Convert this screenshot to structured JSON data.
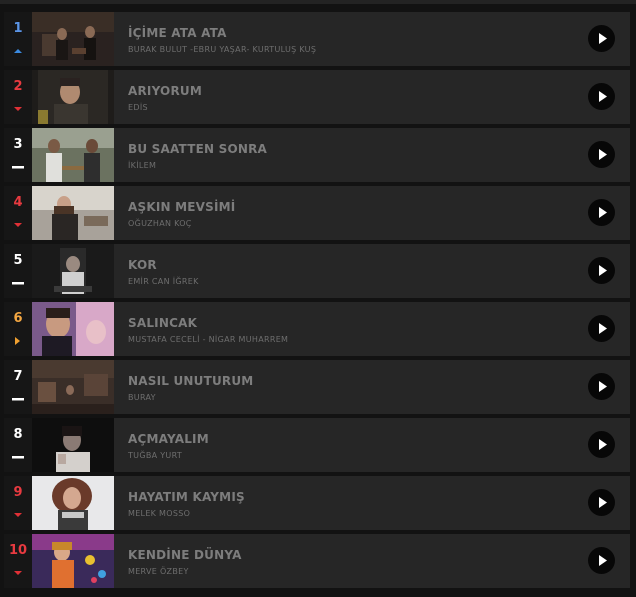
{
  "colors": {
    "up": "#3a8ae0",
    "down": "#e03036",
    "same": "#ffffff",
    "new": "#f0a030",
    "rank_up": "#5b95e8",
    "rank_down": "#e83a40",
    "rank_same": "#ffffff",
    "rank_new": "#f4a742"
  },
  "chart": {
    "items": [
      {
        "rank": "1",
        "trend": "up",
        "title": "İÇİME ATA ATA",
        "artist": "BURAK BULUT -EBRU YAŞAR- KURTULUŞ KUŞ",
        "play_icon": "play-icon"
      },
      {
        "rank": "2",
        "trend": "down",
        "title": "ARIYORUM",
        "artist": "EDİS",
        "play_icon": "play-icon"
      },
      {
        "rank": "3",
        "trend": "same",
        "title": "BU SAATTEN SONRA",
        "artist": "İKİLEM",
        "play_icon": "play-icon"
      },
      {
        "rank": "4",
        "trend": "down",
        "title": "AŞKIN MEVSİMİ",
        "artist": "OĞUZHAN KOÇ",
        "play_icon": "play-icon"
      },
      {
        "rank": "5",
        "trend": "same",
        "title": "KOR",
        "artist": "EMİR CAN İĞREK",
        "play_icon": "play-icon"
      },
      {
        "rank": "6",
        "trend": "new",
        "title": "SALINCAK",
        "artist": "MUSTAFA CECELİ - NİGAR MUHARREM",
        "play_icon": "play-icon"
      },
      {
        "rank": "7",
        "trend": "same",
        "title": "NASIL UNUTURUM",
        "artist": "BURAY",
        "play_icon": "play-icon"
      },
      {
        "rank": "8",
        "trend": "same",
        "title": "AÇMAYALIM",
        "artist": "TUĞBA YURT",
        "play_icon": "play-icon"
      },
      {
        "rank": "9",
        "trend": "down",
        "title": "HAYATIM KAYMIŞ",
        "artist": "MELEK MOSSO",
        "play_icon": "play-icon"
      },
      {
        "rank": "10",
        "trend": "down",
        "title": "KENDİNE DÜNYA",
        "artist": "MERVE ÖZBEY",
        "play_icon": "play-icon"
      }
    ]
  }
}
